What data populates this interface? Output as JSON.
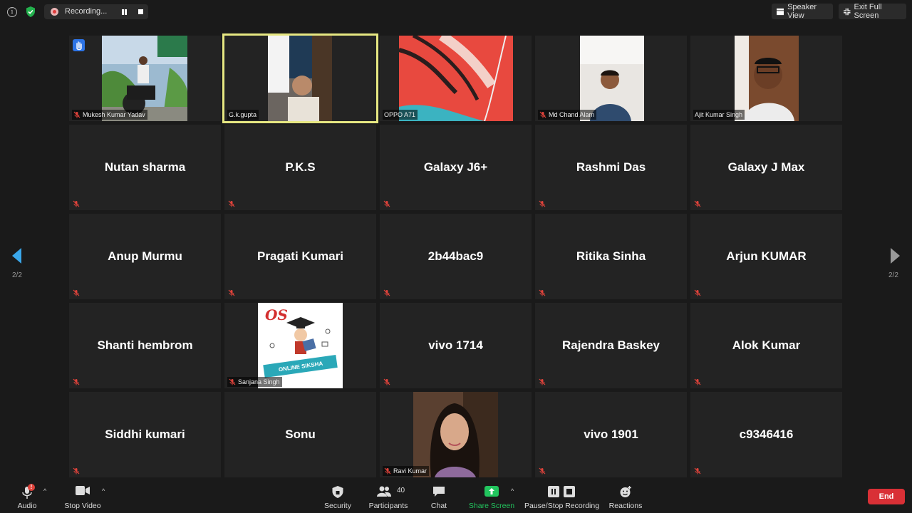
{
  "topbar": {
    "recording_label": "Recording...",
    "speaker_view_label": "Speaker View",
    "exit_fullscreen_label": "Exit Full Screen"
  },
  "participants": [
    {
      "name": "Mukesh Kumar Yadav",
      "muted": true,
      "video": true,
      "hand_raised": true
    },
    {
      "name": "G.k.gupta",
      "muted": false,
      "video": true,
      "active_speaker": true
    },
    {
      "name": "OPPO A71",
      "muted": false,
      "video": true
    },
    {
      "name": "Md Chand Alam",
      "muted": true,
      "video": true
    },
    {
      "name": "Ajit Kumar Singh",
      "muted": false,
      "video": true
    },
    {
      "name": "Nutan sharma",
      "muted": true,
      "video": false
    },
    {
      "name": "P.K.S",
      "muted": true,
      "video": false
    },
    {
      "name": "Galaxy J6+",
      "muted": true,
      "video": false
    },
    {
      "name": "Rashmi Das",
      "muted": true,
      "video": false
    },
    {
      "name": "Galaxy J Max",
      "muted": true,
      "video": false
    },
    {
      "name": "Anup Murmu",
      "muted": true,
      "video": false
    },
    {
      "name": "Pragati Kumari",
      "muted": true,
      "video": false
    },
    {
      "name": "2b44bac9",
      "muted": true,
      "video": false
    },
    {
      "name": "Ritika Sinha",
      "muted": true,
      "video": false
    },
    {
      "name": "Arjun KUMAR",
      "muted": true,
      "video": false
    },
    {
      "name": "Shanti hembrom",
      "muted": true,
      "video": false
    },
    {
      "name": "Sanjana Singh",
      "muted": true,
      "video": true,
      "profile_picture": true
    },
    {
      "name": "vivo 1714",
      "muted": true,
      "video": false
    },
    {
      "name": "Rajendra Baskey",
      "muted": true,
      "video": false
    },
    {
      "name": "Alok Kumar",
      "muted": true,
      "video": false
    },
    {
      "name": "Siddhi kumari",
      "muted": true,
      "video": false
    },
    {
      "name": "Sonu",
      "muted": true,
      "video": false
    },
    {
      "name": "Ravi Kumar",
      "muted": true,
      "video": true
    },
    {
      "name": "vivo 1901",
      "muted": true,
      "video": false
    },
    {
      "name": "c9346416",
      "muted": true,
      "video": false
    }
  ],
  "profile_logo": {
    "letters": "OS",
    "banner_text": "ONLINE SIKSHA"
  },
  "pager": {
    "left_label": "2/2",
    "right_label": "2/2"
  },
  "toolbar": {
    "audio_label": "Audio",
    "audio_badge": "!",
    "video_label": "Stop Video",
    "security_label": "Security",
    "participants_label": "Participants",
    "participants_count": "40",
    "chat_label": "Chat",
    "share_label": "Share Screen",
    "recording_label": "Pause/Stop Recording",
    "reactions_label": "Reactions",
    "end_label": "End"
  },
  "colors": {
    "active_speaker_border": "#e6e782",
    "share_green": "#22c55e",
    "end_red": "#d93036",
    "mute_red": "#e0433b",
    "nav_arrow_blue": "#3aa7ea"
  }
}
